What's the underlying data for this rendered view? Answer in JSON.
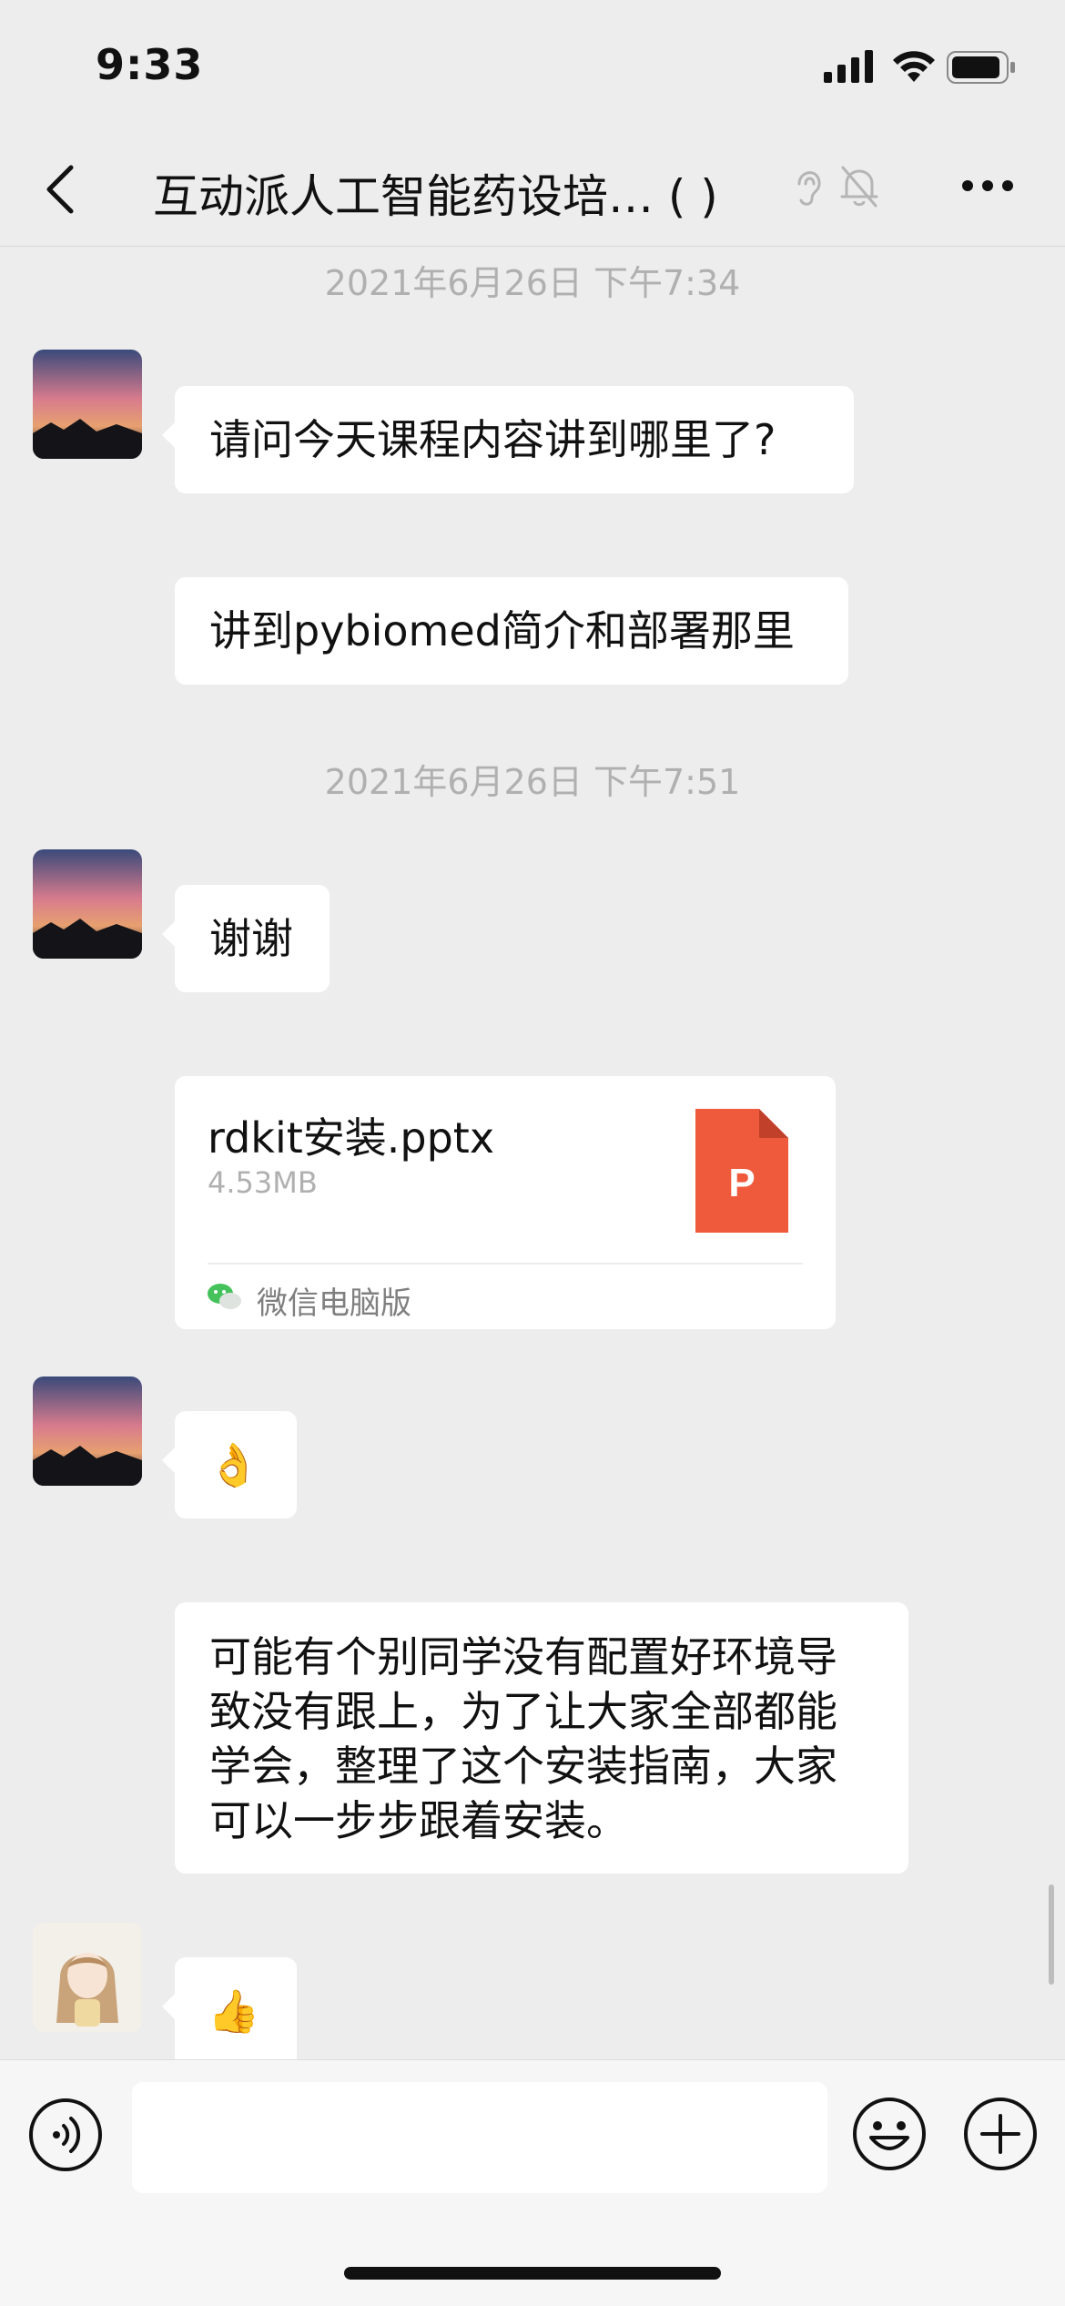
{
  "status_bar": {
    "time": "9:33"
  },
  "header": {
    "title": "互动派人工智能药设培…  (     )"
  },
  "messages": {
    "ts1": "2021年6月26日 下午7:34",
    "m1": "请问今天课程内容讲到哪里了?",
    "m2": "讲到pybiomed简介和部署那里",
    "ts2": "2021年6月26日 下午7:51",
    "m3": "谢谢",
    "file": {
      "name": "rdkit安装.pptx",
      "size": "4.53MB",
      "source": "微信电脑版",
      "icon_letter": "P"
    },
    "m4_emoji": "👌",
    "m5_lines": [
      "可能有个别同学没有配置好环境导",
      "致没有跟上，为了让大家全部都能",
      "学会，整理了这个安装指南，大家",
      "可以一步步跟着安装。"
    ],
    "m6_emoji": "👍"
  },
  "input": {
    "placeholder": ""
  },
  "colors": {
    "ppt_orange": "#f05a3c",
    "background": "#ededed",
    "bubble": "#ffffff"
  }
}
